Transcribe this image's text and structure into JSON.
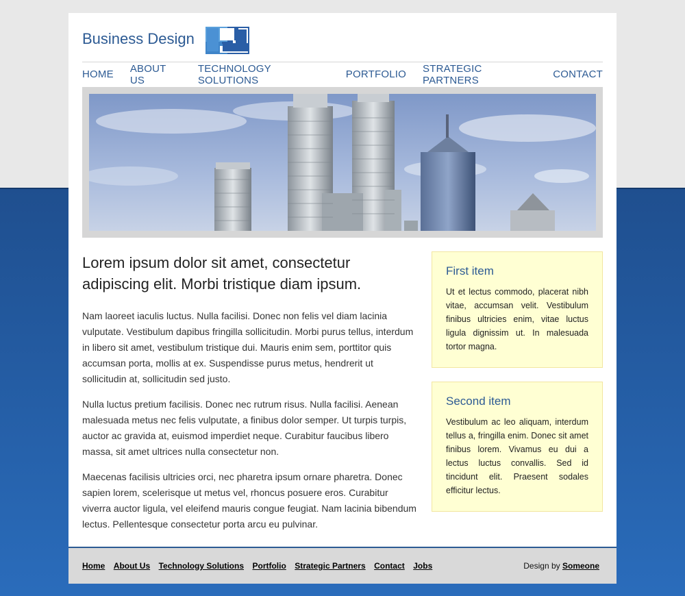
{
  "colors": {
    "brand_blue": "#2c5a93",
    "background_blue": "#2a6cbb",
    "sidebar_box": "#ffffd3",
    "footer_bg": "#d9d9d9"
  },
  "header": {
    "title": "Business Design",
    "logo_icon": "logo-icon"
  },
  "nav": {
    "items": [
      {
        "label": "HOME"
      },
      {
        "label": "ABOUT US"
      },
      {
        "label": "TECHNOLOGY SOLUTIONS"
      },
      {
        "label": "PORTFOLIO"
      },
      {
        "label": "STRATEGIC PARTNERS"
      },
      {
        "label": "CONTACT"
      }
    ]
  },
  "main": {
    "heading": "Lorem ipsum dolor sit amet, consectetur adipiscing elit. Morbi tristique diam ipsum.",
    "paragraphs": [
      "Nam laoreet iaculis luctus. Nulla facilisi. Donec non felis vel diam lacinia vulputate. Vestibulum dapibus fringilla sollicitudin. Morbi purus tellus, interdum in libero sit amet, vestibulum tristique dui. Mauris enim sem, porttitor quis accumsan porta, mollis at ex. Suspendisse purus metus, hendrerit ut sollicitudin at, sollicitudin sed justo.",
      "Nulla luctus pretium facilisis. Donec nec rutrum risus. Nulla facilisi. Aenean malesuada metus nec felis vulputate, a finibus dolor semper. Ut turpis turpis, auctor ac gravida at, euismod imperdiet neque. Curabitur faucibus libero massa, sit amet ultrices nulla consectetur non.",
      "Maecenas facilisis ultricies orci, nec pharetra ipsum ornare pharetra. Donec sapien lorem, scelerisque ut metus vel, rhoncus posuere eros. Curabitur viverra auctor ligula, vel eleifend mauris congue feugiat. Nam lacinia bibendum lectus. Pellentesque consectetur porta arcu eu pulvinar."
    ]
  },
  "sidebar": {
    "items": [
      {
        "title": "First item",
        "text": "Ut et lectus commodo, placerat nibh vitae, accumsan velit. Vestibulum finibus ultricies enim, vitae luctus ligula dignissim ut. In malesuada tortor magna."
      },
      {
        "title": "Second item",
        "text": "Vestibulum ac leo aliquam, interdum tellus a, fringilla enim. Donec sit amet finibus lorem. Vivamus eu dui a lectus luctus convallis. Sed id tincidunt elit. Praesent sodales efficitur lectus."
      }
    ]
  },
  "footer": {
    "links": [
      {
        "label": "Home"
      },
      {
        "label": "About Us"
      },
      {
        "label": "Technology Solutions"
      },
      {
        "label": "Portfolio"
      },
      {
        "label": "Strategic Partners"
      },
      {
        "label": "Contact"
      },
      {
        "label": "Jobs"
      }
    ],
    "credit_prefix": "Design by",
    "credit_link": "Someone"
  }
}
